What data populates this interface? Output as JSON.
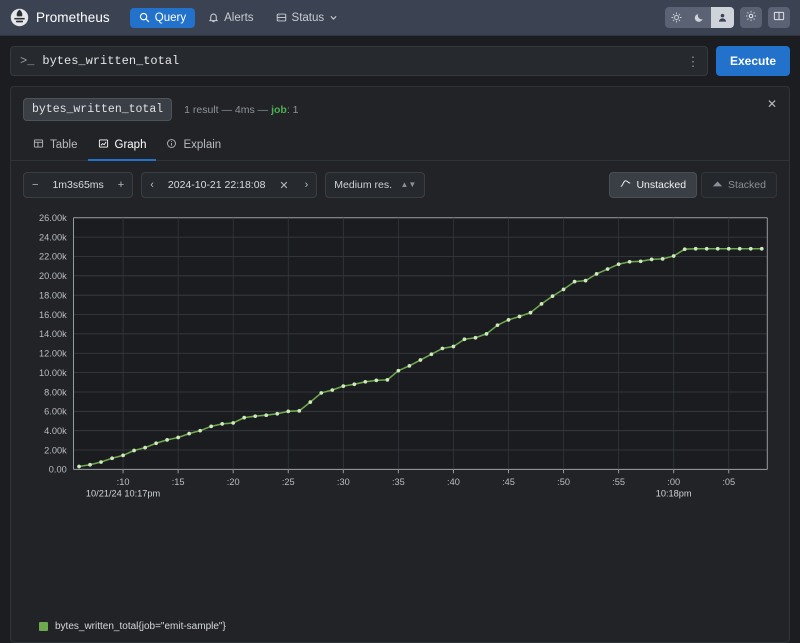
{
  "navbar": {
    "brand": "Prometheus",
    "links": [
      {
        "label": "Query",
        "icon": "search-icon",
        "active": true
      },
      {
        "label": "Alerts",
        "icon": "bell-icon",
        "active": false
      },
      {
        "label": "Status",
        "icon": "server-icon",
        "active": false
      }
    ],
    "theme_options": [
      "light-sun-icon",
      "dark-moon-icon",
      "auto-person-icon"
    ],
    "settings_icon": "gear-icon",
    "docs_icon": "book-icon"
  },
  "query": {
    "prompt": ">_",
    "value": "bytes_written_total",
    "menu_icon": "vertical-dots-icon",
    "execute_label": "Execute"
  },
  "result": {
    "metric_badge": "bytes_written_total",
    "meta_count": "1 result",
    "meta_sep1": "—",
    "meta_time": "4ms",
    "meta_sep2": "—",
    "meta_label_job": "job",
    "meta_job_value": ": 1",
    "close_icon": "✕"
  },
  "tabs": [
    {
      "label": "Table",
      "icon": "table-icon",
      "active": false
    },
    {
      "label": "Graph",
      "icon": "graph-icon",
      "active": true
    },
    {
      "label": "Explain",
      "icon": "info-icon",
      "active": false
    }
  ],
  "controls": {
    "range_minus": "−",
    "range_value": "1m3s65ms",
    "range_plus": "+",
    "time_prev": "‹",
    "time_value": "2024-10-21 22:18:08",
    "time_clear": "✕",
    "time_next": "›",
    "resolution_value": "Medium res.",
    "unstacked_label": "Unstacked",
    "stacked_label": "Stacked",
    "stack_mode": "Unstacked"
  },
  "legend": {
    "series_label": "bytes_written_total{job=\"emit-sample\"}",
    "color": "#6ea84f"
  },
  "chart_data": {
    "type": "line",
    "title": "",
    "xlabel": "",
    "ylabel": "",
    "ylim": [
      0,
      26000
    ],
    "y_ticks": [
      "0.00",
      "2.00k",
      "4.00k",
      "6.00k",
      "8.00k",
      "10.00k",
      "12.00k",
      "14.00k",
      "16.00k",
      "18.00k",
      "20.00k",
      "22.00k",
      "24.00k",
      "26.00k"
    ],
    "y_tick_values": [
      0,
      2000,
      4000,
      6000,
      8000,
      10000,
      12000,
      14000,
      16000,
      18000,
      20000,
      22000,
      24000,
      26000
    ],
    "x_ticks": [
      ":10",
      ":15",
      ":20",
      ":25",
      ":30",
      ":35",
      ":40",
      ":45",
      ":50",
      ":55",
      ":00",
      ":05"
    ],
    "x_tick_seconds": [
      10,
      15,
      20,
      25,
      30,
      35,
      40,
      45,
      50,
      55,
      60,
      65
    ],
    "x_axis_sublabels": [
      {
        "tick": ":10",
        "text": "10/21/24 10:17pm"
      },
      {
        "tick": ":00",
        "text": "10:18pm"
      }
    ],
    "x_range_seconds": [
      5.5,
      68.5
    ],
    "grid": true,
    "legend_position": "bottom-left",
    "series": [
      {
        "name": "bytes_written_total{job=\"emit-sample\"}",
        "color": "#6ea84f",
        "marker": "circle",
        "x": [
          6,
          7,
          8,
          9,
          10,
          11,
          12,
          13,
          14,
          15,
          16,
          17,
          18,
          19,
          20,
          21,
          22,
          23,
          24,
          25,
          26,
          27,
          28,
          29,
          30,
          31,
          32,
          33,
          34,
          35,
          36,
          37,
          38,
          39,
          40,
          41,
          42,
          43,
          44,
          45,
          46,
          47,
          48,
          49,
          50,
          51,
          52,
          53,
          54,
          55,
          56,
          57,
          58,
          59,
          60,
          61,
          62,
          63,
          64,
          65,
          66,
          67,
          68
        ],
        "values": [
          300,
          480,
          760,
          1150,
          1450,
          1950,
          2250,
          2700,
          3050,
          3300,
          3700,
          4000,
          4450,
          4700,
          4800,
          5350,
          5500,
          5600,
          5750,
          6000,
          6050,
          6950,
          7900,
          8200,
          8600,
          8800,
          9050,
          9200,
          9250,
          10200,
          10700,
          11300,
          11900,
          12500,
          12700,
          13450,
          13600,
          14000,
          14900,
          15450,
          15800,
          16200,
          17100,
          17900,
          18600,
          19400,
          19500,
          20200,
          20700,
          21200,
          21450,
          21500,
          21700,
          21750,
          22050,
          22750,
          22800,
          22800,
          22800,
          22800,
          22800,
          22800,
          22800
        ]
      }
    ]
  }
}
